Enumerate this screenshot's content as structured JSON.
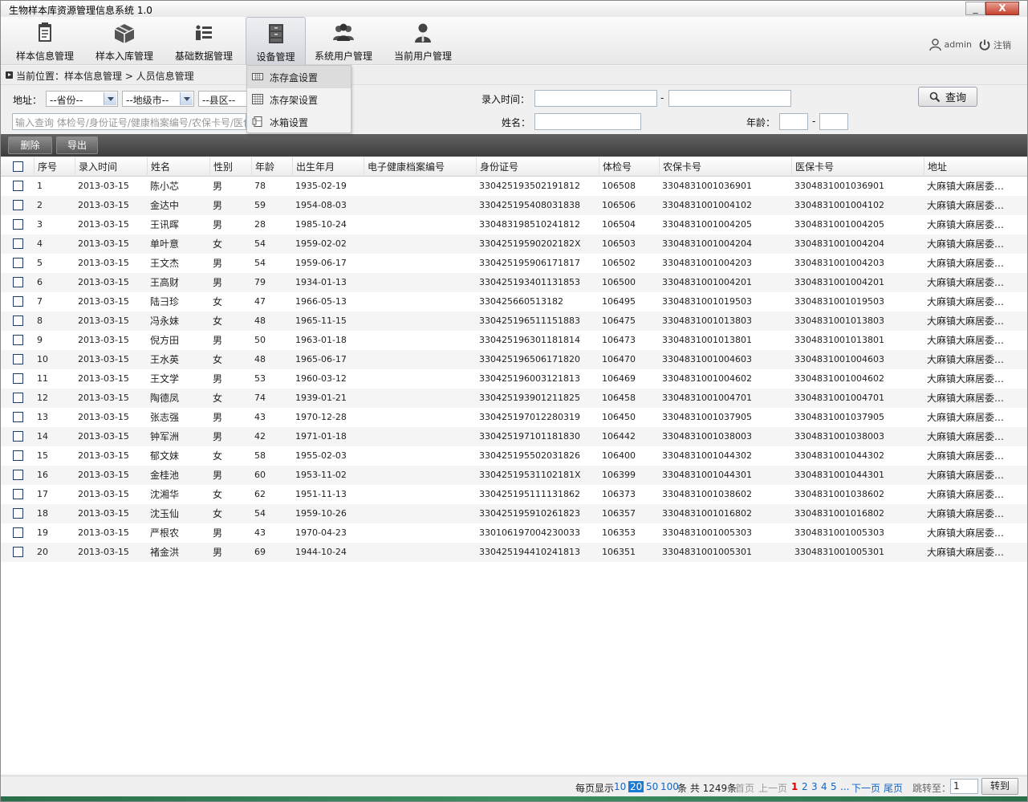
{
  "window": {
    "title": "生物样本库资源管理信息系统 1.0",
    "min": "_",
    "close": "X"
  },
  "menu": {
    "items": [
      {
        "label": "样本信息管理",
        "icon": "clipboard-icon"
      },
      {
        "label": "样本入库管理",
        "icon": "box-icon"
      },
      {
        "label": "基础数据管理",
        "icon": "list-icon"
      },
      {
        "label": "设备管理",
        "icon": "cabinet-icon"
      },
      {
        "label": "系统用户管理",
        "icon": "users-icon"
      },
      {
        "label": "当前用户管理",
        "icon": "user-icon"
      }
    ],
    "active_index": 3
  },
  "user": {
    "name": "admin",
    "logout": "注销"
  },
  "breadcrumb": "当前位置：样本信息管理 > 人员信息管理",
  "dropdown": {
    "items": [
      "冻存盒设置",
      "冻存架设置",
      "冰箱设置"
    ],
    "highlighted": 0
  },
  "filters": {
    "address_label": "地址：",
    "province": "--省份--",
    "city": "--地级市--",
    "county": "--县区--",
    "search_placeholder": "输入查询 体检号/身份证号/健康档案编号/农保卡号/医保",
    "entry_time_label": "录入时间：",
    "range_sep": "-",
    "name_label": "姓名：",
    "age_label": "年龄：",
    "search_button": "查询"
  },
  "toolbar": {
    "delete": "删除",
    "export": "导出"
  },
  "table": {
    "headers": [
      "序号",
      "录入时间",
      "姓名",
      "性别",
      "年龄",
      "出生年月",
      "电子健康档案编号",
      "身份证号",
      "体检号",
      "农保卡号",
      "医保卡号",
      "地址"
    ],
    "rows": [
      [
        "1",
        "2013-03-15",
        "陈小芯",
        "男",
        "78",
        "1935-02-19",
        "",
        "330425193502191812",
        "106508",
        "3304831001036901",
        "3304831001036901",
        "大麻镇大麻居委…"
      ],
      [
        "2",
        "2013-03-15",
        "金达中",
        "男",
        "59",
        "1954-08-03",
        "",
        "330425195408031838",
        "106506",
        "3304831001004102",
        "3304831001004102",
        "大麻镇大麻居委…"
      ],
      [
        "3",
        "2013-03-15",
        "王讯晖",
        "男",
        "28",
        "1985-10-24",
        "",
        "330483198510241812",
        "106504",
        "3304831001004205",
        "3304831001004205",
        "大麻镇大麻居委…"
      ],
      [
        "4",
        "2013-03-15",
        "单叶意",
        "女",
        "54",
        "1959-02-02",
        "",
        "33042519590202182X",
        "106503",
        "3304831001004204",
        "3304831001004204",
        "大麻镇大麻居委…"
      ],
      [
        "5",
        "2013-03-15",
        "王文杰",
        "男",
        "54",
        "1959-06-17",
        "",
        "330425195906171817",
        "106502",
        "3304831001004203",
        "3304831001004203",
        "大麻镇大麻居委…"
      ],
      [
        "6",
        "2013-03-15",
        "王高财",
        "男",
        "79",
        "1934-01-13",
        "",
        "330425193401131853",
        "106500",
        "3304831001004201",
        "3304831001004201",
        "大麻镇大麻居委…"
      ],
      [
        "7",
        "2013-03-15",
        "陆彐珍",
        "女",
        "47",
        "1966-05-13",
        "",
        "330425660513182",
        "106495",
        "3304831001019503",
        "3304831001019503",
        "大麻镇大麻居委…"
      ],
      [
        "8",
        "2013-03-15",
        "冯永妹",
        "女",
        "48",
        "1965-11-15",
        "",
        "330425196511151883",
        "106475",
        "3304831001013803",
        "3304831001013803",
        "大麻镇大麻居委…"
      ],
      [
        "9",
        "2013-03-15",
        "倪方田",
        "男",
        "50",
        "1963-01-18",
        "",
        "330425196301181814",
        "106473",
        "3304831001013801",
        "3304831001013801",
        "大麻镇大麻居委…"
      ],
      [
        "10",
        "2013-03-15",
        "王水英",
        "女",
        "48",
        "1965-06-17",
        "",
        "330425196506171820",
        "106470",
        "3304831001004603",
        "3304831001004603",
        "大麻镇大麻居委…"
      ],
      [
        "11",
        "2013-03-15",
        "王文学",
        "男",
        "53",
        "1960-03-12",
        "",
        "330425196003121813",
        "106469",
        "3304831001004602",
        "3304831001004602",
        "大麻镇大麻居委…"
      ],
      [
        "12",
        "2013-03-15",
        "陶德凤",
        "女",
        "74",
        "1939-01-21",
        "",
        "330425193901211825",
        "106458",
        "3304831001004701",
        "3304831001004701",
        "大麻镇大麻居委…"
      ],
      [
        "13",
        "2013-03-15",
        "张志强",
        "男",
        "43",
        "1970-12-28",
        "",
        "330425197012280319",
        "106450",
        "3304831001037905",
        "3304831001037905",
        "大麻镇大麻居委…"
      ],
      [
        "14",
        "2013-03-15",
        "钟军洲",
        "男",
        "42",
        "1971-01-18",
        "",
        "330425197101181830",
        "106442",
        "3304831001038003",
        "3304831001038003",
        "大麻镇大麻居委…"
      ],
      [
        "15",
        "2013-03-15",
        "郁文妹",
        "女",
        "58",
        "1955-02-03",
        "",
        "330425195502031826",
        "106400",
        "3304831001044302",
        "3304831001044302",
        "大麻镇大麻居委…"
      ],
      [
        "16",
        "2013-03-15",
        "金桂池",
        "男",
        "60",
        "1953-11-02",
        "",
        "33042519531102181X",
        "106399",
        "3304831001044301",
        "3304831001044301",
        "大麻镇大麻居委…"
      ],
      [
        "17",
        "2013-03-15",
        "沈湘华",
        "女",
        "62",
        "1951-11-13",
        "",
        "330425195111131862",
        "106373",
        "3304831001038602",
        "3304831001038602",
        "大麻镇大麻居委…"
      ],
      [
        "18",
        "2013-03-15",
        "沈玉仙",
        "女",
        "54",
        "1959-10-26",
        "",
        "330425195910261823",
        "106357",
        "3304831001016802",
        "3304831001016802",
        "大麻镇大麻居委…"
      ],
      [
        "19",
        "2013-03-15",
        "严根农",
        "男",
        "43",
        "1970-04-23",
        "",
        "330106197004230033",
        "106353",
        "3304831001005303",
        "3304831001005303",
        "大麻镇大麻居委…"
      ],
      [
        "20",
        "2013-03-15",
        "褚金洪",
        "男",
        "69",
        "1944-10-24",
        "",
        "330425194410241813",
        "106351",
        "3304831001005301",
        "3304831001005301",
        "大麻镇大麻居委…"
      ]
    ]
  },
  "pager": {
    "per_page_label": "每页显示",
    "sizes": [
      "10",
      "20",
      "50",
      "100"
    ],
    "current_size": "20",
    "total": "条 共 1249条",
    "first": "首页",
    "prev": "上一页",
    "pages": [
      "1",
      "2",
      "3",
      "4",
      "5"
    ],
    "current_page": "1",
    "ellipsis": "...",
    "next": "下一页",
    "last": "尾页",
    "jump_label": "跳转至：",
    "jump_value": "1",
    "go": "转到"
  }
}
